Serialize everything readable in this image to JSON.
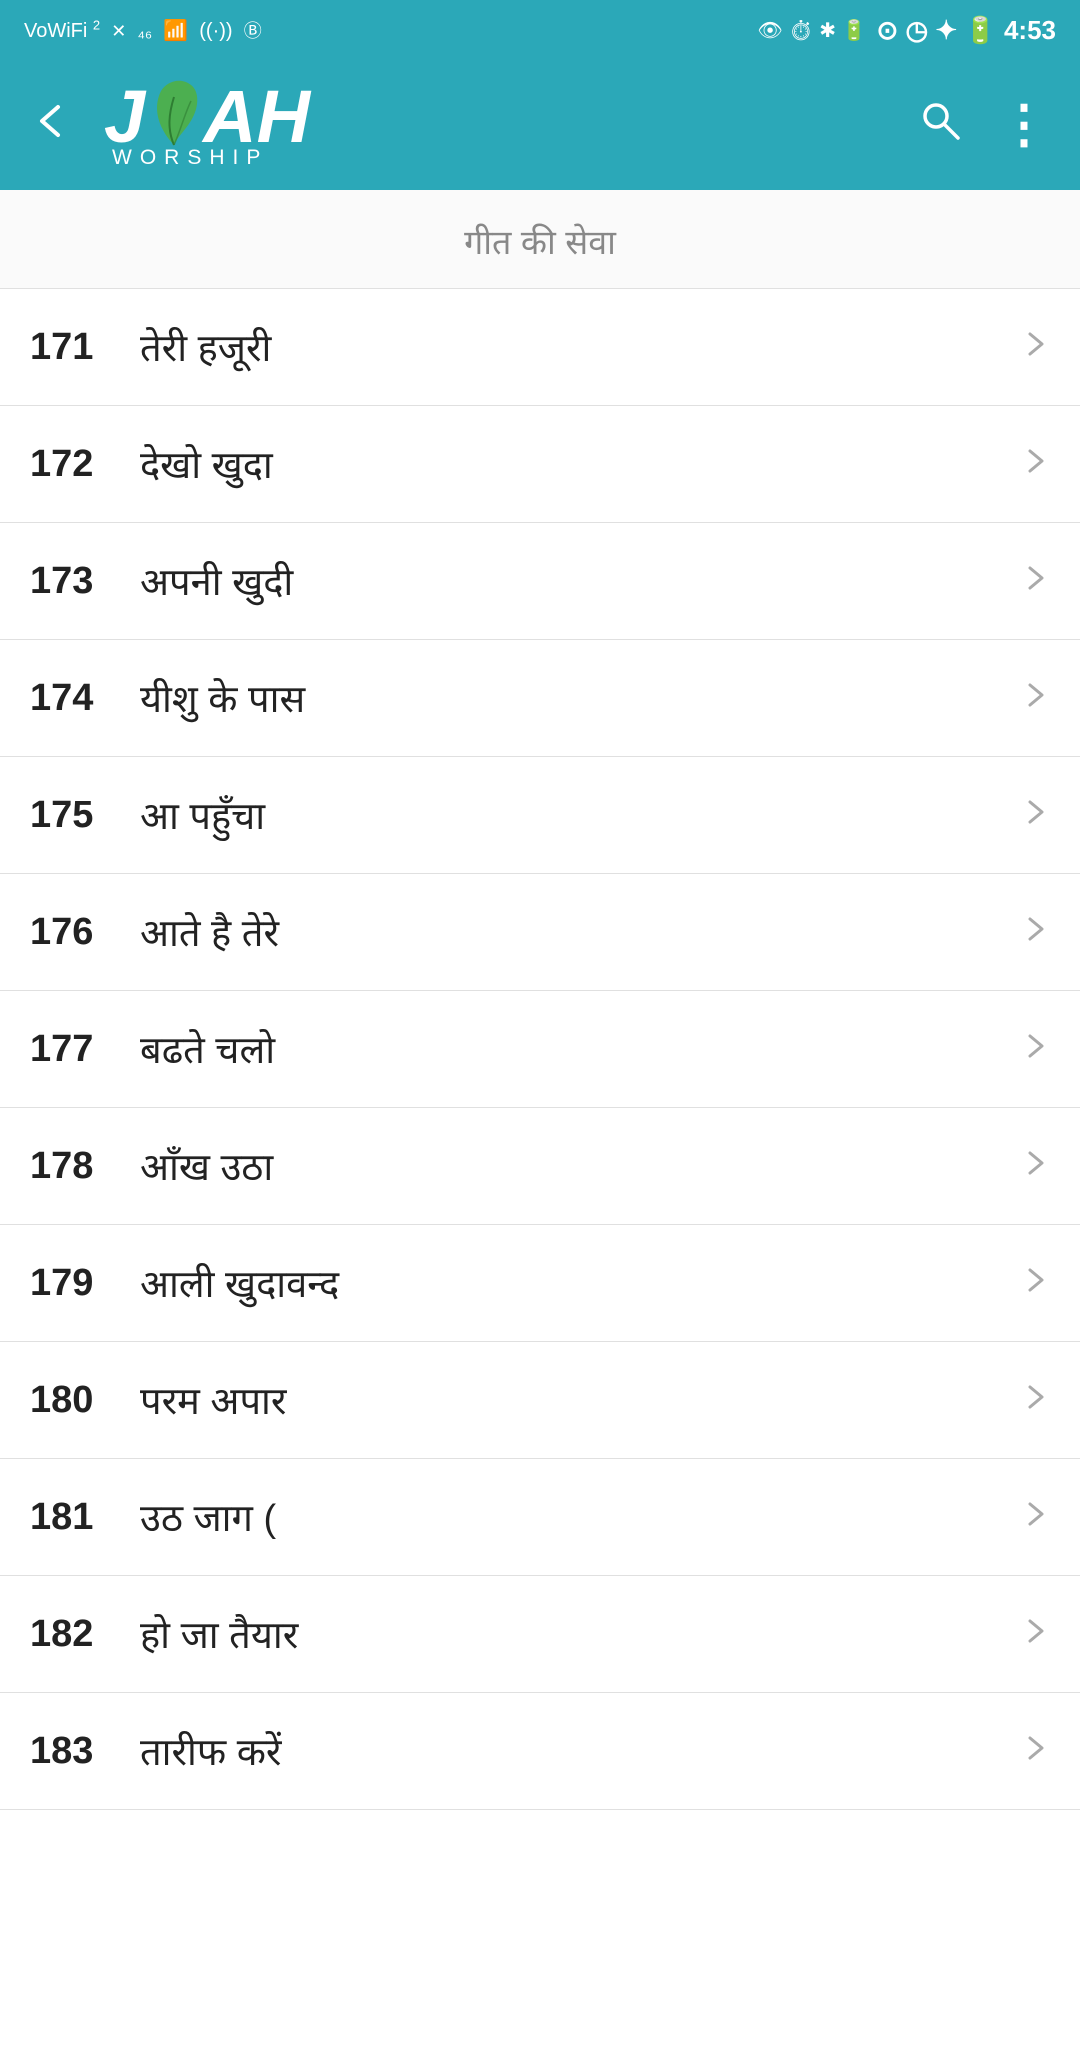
{
  "statusBar": {
    "left": "VoWiFi 2 46 ● ◎",
    "right": "⊙ ◷ ✦ 🔋 4:53"
  },
  "appBar": {
    "backLabel": "←",
    "logoJ": "J",
    "logoAH": "AH",
    "logoWorship": "WORSHIP",
    "searchLabel": "🔍",
    "moreLabel": "⋮"
  },
  "sectionTitle": "गीत की सेवा",
  "songs": [
    {
      "number": "171",
      "title": "तेरी हजूरी"
    },
    {
      "number": "172",
      "title": "देखो खुदा"
    },
    {
      "number": "173",
      "title": "अपनी खुदी"
    },
    {
      "number": "174",
      "title": "यीशु के पास"
    },
    {
      "number": "175",
      "title": "आ पहुँचा"
    },
    {
      "number": "176",
      "title": "आते है तेरे"
    },
    {
      "number": "177",
      "title": "बढते चलो"
    },
    {
      "number": "178",
      "title": "आँख उठा"
    },
    {
      "number": "179",
      "title": "आली खुदावन्द"
    },
    {
      "number": "180",
      "title": "परम अपार"
    },
    {
      "number": "181",
      "title": "उठ जाग ("
    },
    {
      "number": "182",
      "title": "हो जा तैयार"
    },
    {
      "number": "183",
      "title": "तारीफ करें"
    }
  ],
  "colors": {
    "teal": "#2ba8b8",
    "white": "#ffffff",
    "text": "#222222",
    "divider": "#e0e0e0",
    "chevron": "#aaaaaa",
    "subtitle": "#888888"
  }
}
